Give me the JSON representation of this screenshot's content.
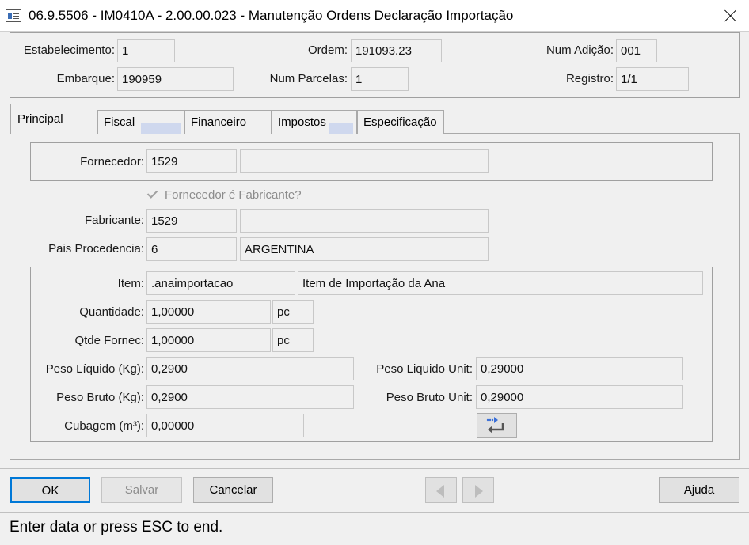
{
  "window": {
    "title": "06.9.5506 - IM0410A - 2.00.00.023 - Manutenção Ordens Declaração Importação"
  },
  "header": {
    "estabelecimento_label": "Estabelecimento:",
    "estabelecimento_value": "1",
    "ordem_label": "Ordem:",
    "ordem_value": "191093.23",
    "num_adicao_label": "Num Adição:",
    "num_adicao_value": "001",
    "embarque_label": "Embarque:",
    "embarque_value": "190959",
    "num_parcelas_label": "Num Parcelas:",
    "num_parcelas_value": "1",
    "registro_label": "Registro:",
    "registro_value": "1/1"
  },
  "tabs": [
    {
      "label": "Principal",
      "active": true
    },
    {
      "label": "Fiscal",
      "active": false
    },
    {
      "label": "Financeiro",
      "active": false
    },
    {
      "label": "Impostos",
      "active": false
    },
    {
      "label": "Especificação",
      "active": false
    }
  ],
  "principal": {
    "fornecedor_label": "Fornecedor:",
    "fornecedor_code": "1529",
    "fornecedor_name": "",
    "fornecedor_fabricante_label": "Fornecedor é Fabricante?",
    "fornecedor_fabricante_checked": true,
    "fabricante_label": "Fabricante:",
    "fabricante_code": "1529",
    "fabricante_name": "",
    "pais_label": "Pais Procedencia:",
    "pais_code": "6",
    "pais_name": "ARGENTINA",
    "item_label": "Item:",
    "item_code": ".anaimportacao",
    "item_desc": "Item de Importação da Ana",
    "quantidade_label": "Quantidade:",
    "quantidade_value": "1,00000",
    "quantidade_unit": "pc",
    "qtde_fornec_label": "Qtde Fornec:",
    "qtde_fornec_value": "1,00000",
    "qtde_fornec_unit": "pc",
    "peso_liquido_label": "Peso Líquido (Kg):",
    "peso_liquido_value": "0,2900",
    "peso_liquido_unit_label": "Peso Liquido Unit:",
    "peso_liquido_unit_value": "0,29000",
    "peso_bruto_label": "Peso Bruto (Kg):",
    "peso_bruto_value": "0,2900",
    "peso_bruto_unit_label": "Peso Bruto Unit:",
    "peso_bruto_unit_value": "0,29000",
    "cubagem_label": "Cubagem (m³):",
    "cubagem_value": "0,00000"
  },
  "buttons": {
    "ok": "OK",
    "salvar": "Salvar",
    "cancelar": "Cancelar",
    "ajuda": "Ajuda"
  },
  "status_text": "Enter data or press ESC to end.",
  "icons": {
    "window": "app-window-icon",
    "close": "close-icon",
    "refresh": "recalc-arrows-icon",
    "prev": "previous-arrow-icon",
    "next": "next-arrow-icon",
    "check": "check-icon"
  },
  "colors": {
    "default_button_border": "#0078d7",
    "tab_fill": "#cfd8ee"
  }
}
